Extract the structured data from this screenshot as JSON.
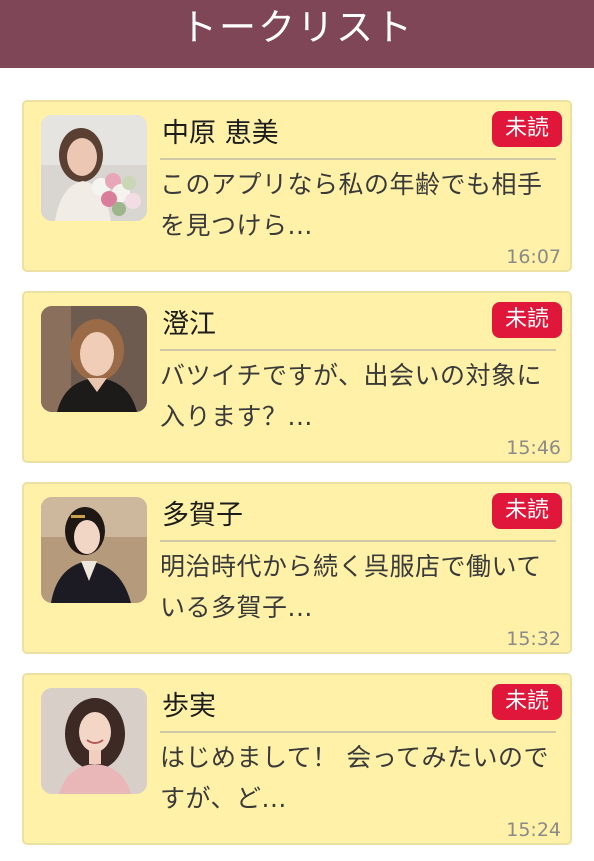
{
  "header": {
    "title": "トークリスト"
  },
  "colors": {
    "header_bg": "#7e4656",
    "card_bg": "#fff2a8",
    "badge_bg": "#e0173a"
  },
  "conversations": [
    {
      "name": "中原 恵美",
      "badge": "未読",
      "preview": "このアプリなら私の年齢でも相手を見つけら...",
      "time": "16:07",
      "avatar_icon": "woman-with-flowers-avatar"
    },
    {
      "name": "澄江",
      "badge": "未読",
      "preview": "バツイチですが、出会いの対象に入ります？...",
      "time": "15:46",
      "avatar_icon": "woman-portrait-avatar"
    },
    {
      "name": "多賀子",
      "badge": "未読",
      "preview": "明治時代から続く呉服店で働いている多賀子...",
      "time": "15:32",
      "avatar_icon": "woman-in-kimono-avatar"
    },
    {
      "name": "歩実",
      "badge": "未読",
      "preview": "はじめまして！ 会ってみたいのですが、ど...",
      "time": "15:24",
      "avatar_icon": "smiling-woman-avatar"
    }
  ]
}
